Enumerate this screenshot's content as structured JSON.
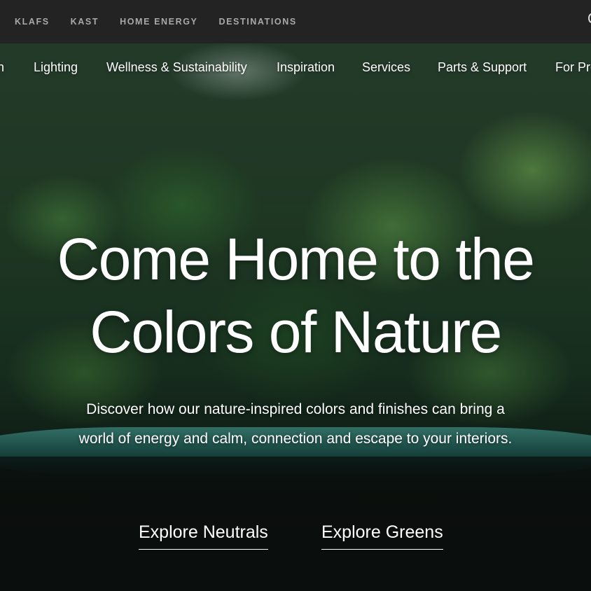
{
  "top_bar": {
    "links": [
      "KLAFS",
      "KAST",
      "HOME ENERGY",
      "DESTINATIONS"
    ]
  },
  "main_nav": {
    "items": [
      "n",
      "Lighting",
      "Wellness & Sustainability",
      "Inspiration",
      "Services",
      "Parts & Support",
      "For Pro"
    ]
  },
  "hero": {
    "headline_line1": "Come Home to the",
    "headline_line2": "Colors of Nature",
    "subtext": "Discover how our nature-inspired colors and finishes can bring a world of energy and calm, connection and escape to your interiors.",
    "cta_primary": "Explore Neutrals",
    "cta_secondary": "Explore Greens"
  },
  "colors": {
    "top_bar_bg": "#232323",
    "top_bar_text": "#a9a9a9",
    "hero_text": "#ffffff"
  }
}
